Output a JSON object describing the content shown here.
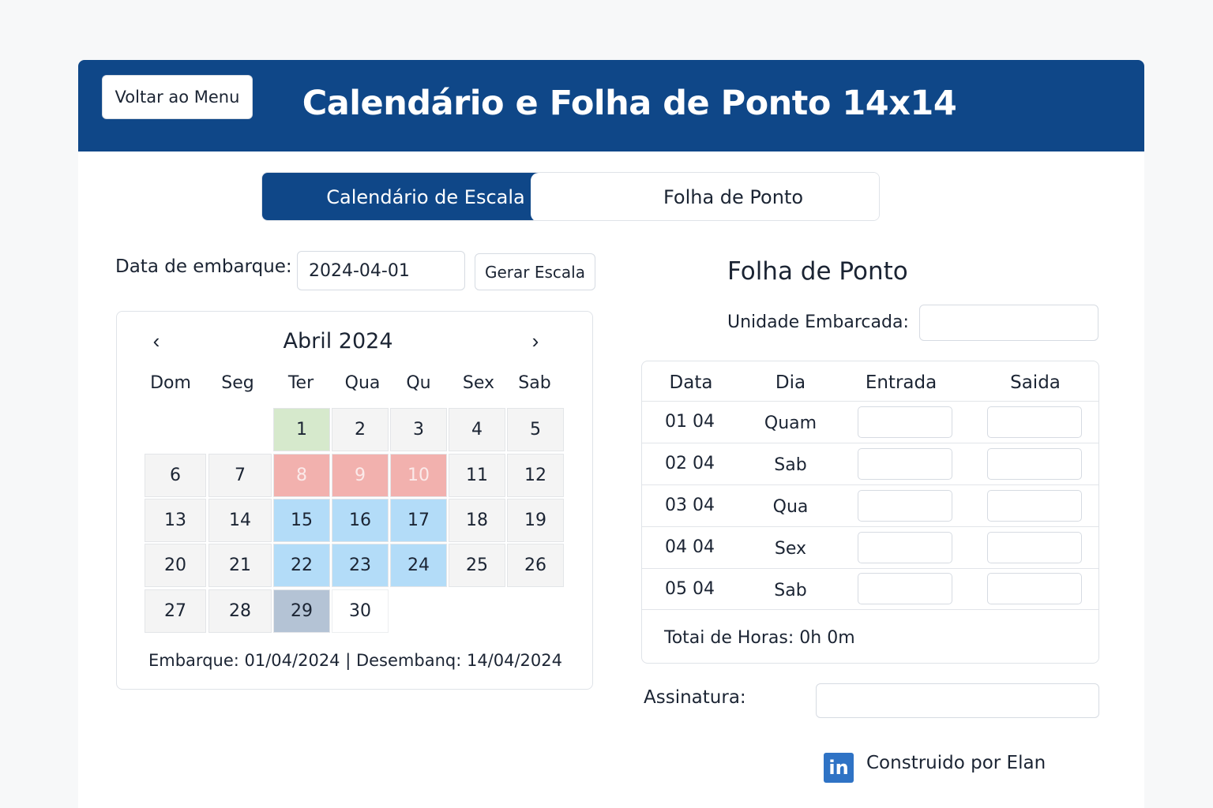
{
  "header": {
    "back_label": "Voltar ao Menu",
    "title": "Calendário e Folha de Ponto 14x14",
    "color": "#0f4788"
  },
  "tabs": [
    {
      "label": "Calendário de Escala",
      "active": true
    },
    {
      "label": "Folha de Ponto",
      "active": false
    }
  ],
  "form": {
    "date_label": "Data de embarque:",
    "date_value": "2024-04-01",
    "generate_label": "Gerar Escala"
  },
  "calendar": {
    "prev_icon": "‹",
    "next_icon": "›",
    "month": "Abril 2024",
    "weekdays": [
      "Dom",
      "Seg",
      "Ter",
      "Qua",
      "Qu",
      "Sex",
      "Sab"
    ],
    "days": [
      "1",
      "2",
      "3",
      "4",
      "5",
      "6",
      "7",
      "8",
      "9",
      "10",
      "11",
      "12",
      "13",
      "14",
      "15",
      "16",
      "17",
      "18",
      "19",
      "20",
      "21",
      "22",
      "23",
      "24",
      "25",
      "26",
      "27",
      "28",
      "29",
      "30"
    ],
    "status_colors": {
      "embark": "#d6e9cc",
      "off": "#f2b1ae",
      "work": "#b3dcf8",
      "today": "#b4c3d5"
    },
    "summary": "Embarque: 01/04/2024 | Desembanq: 14/04/2024"
  },
  "timesheet": {
    "title": "Folha de Ponto",
    "unit_label": "Unidade Embarcada:",
    "unit_value": "",
    "columns": [
      "Data",
      "Dia",
      "Entrada",
      "Saida"
    ],
    "rows": [
      {
        "date": "01 04",
        "day": "Quam"
      },
      {
        "date": "02 04",
        "day": "Sab"
      },
      {
        "date": "03 04",
        "day": "Qua"
      },
      {
        "date": "04 04",
        "day": "Sex"
      },
      {
        "date": "05 04",
        "day": "Sab"
      }
    ],
    "total_label": "Totai de Horas:",
    "total_value": "0h 0m",
    "signature_label": "Assinatura:"
  },
  "footer": {
    "icon": "linkedin-icon",
    "icon_text": "in",
    "credit": "Construido por Elan"
  }
}
